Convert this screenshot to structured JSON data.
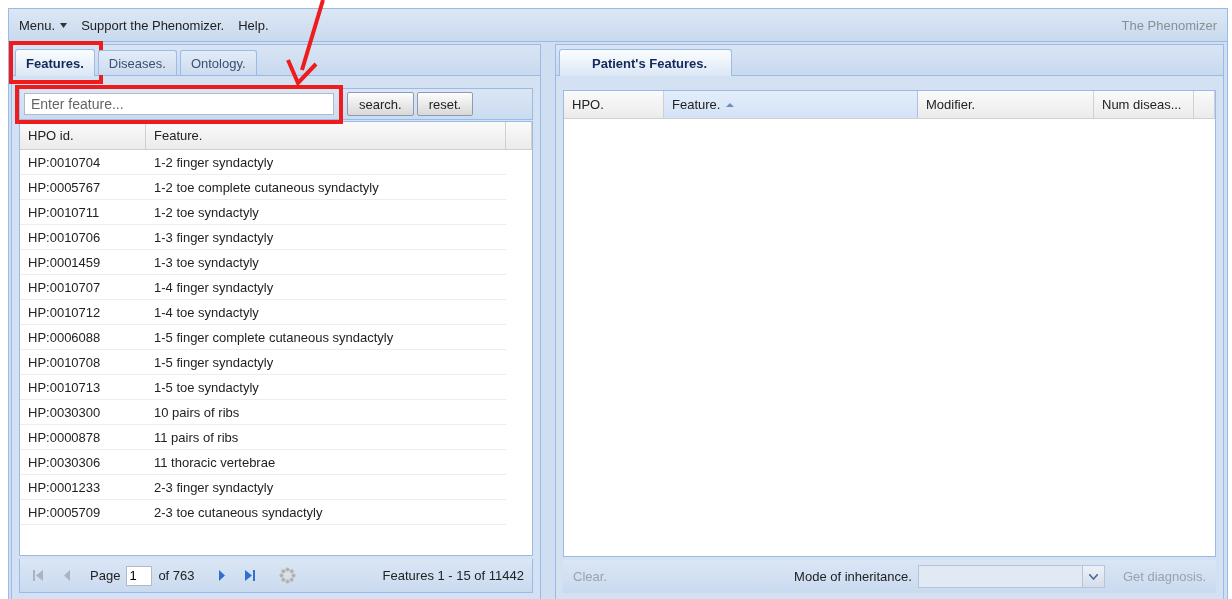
{
  "menu": [
    {
      "label": "Menu.",
      "dropdown": true
    },
    {
      "label": "Support the Phenomizer.",
      "dropdown": false
    },
    {
      "label": "Help.",
      "dropdown": false
    }
  ],
  "app_title": "The Phenomizer",
  "left_panel": {
    "tabs": [
      {
        "label": "Features.",
        "selected": true,
        "highlighted": true
      },
      {
        "label": "Diseases.",
        "selected": false,
        "highlighted": false
      },
      {
        "label": "Ontology.",
        "selected": false,
        "highlighted": false
      }
    ],
    "search": {
      "placeholder": "Enter feature...",
      "highlighted": true,
      "arrow": true
    },
    "buttons": [
      "search.",
      "reset."
    ],
    "grid": {
      "columns": [
        {
          "label": "HPO id."
        },
        {
          "label": "Feature."
        }
      ],
      "rows": [
        [
          "HP:0010704",
          "1-2 finger syndactyly"
        ],
        [
          "HP:0005767",
          "1-2 toe complete cutaneous syndactyly"
        ],
        [
          "HP:0010711",
          "1-2 toe syndactyly"
        ],
        [
          "HP:0010706",
          "1-3 finger syndactyly"
        ],
        [
          "HP:0001459",
          "1-3 toe syndactyly"
        ],
        [
          "HP:0010707",
          "1-4 finger syndactyly"
        ],
        [
          "HP:0010712",
          "1-4 toe syndactyly"
        ],
        [
          "HP:0006088",
          "1-5 finger complete cutaneous syndactyly"
        ],
        [
          "HP:0010708",
          "1-5 finger syndactyly"
        ],
        [
          "HP:0010713",
          "1-5 toe syndactyly"
        ],
        [
          "HP:0030300",
          "10 pairs of ribs"
        ],
        [
          "HP:0000878",
          "11 pairs of ribs"
        ],
        [
          "HP:0030306",
          "11 thoracic vertebrae"
        ],
        [
          "HP:0001233",
          "2-3 finger syndactyly"
        ],
        [
          "HP:0005709",
          "2-3 toe cutaneous syndactyly"
        ]
      ]
    },
    "pager": {
      "nav": [
        {
          "kind": "first",
          "disabled": true
        },
        {
          "kind": "prev",
          "disabled": true
        },
        {
          "kind": "page"
        },
        {
          "kind": "next",
          "disabled": false
        },
        {
          "kind": "last",
          "disabled": false
        },
        {
          "kind": "refresh",
          "disabled": true
        }
      ],
      "page_label": "Page",
      "page": "1",
      "page_count": "of 763",
      "summary": "Features 1 - 15 of 11442"
    }
  },
  "right_panel": {
    "tabs": [
      {
        "label": "Patient's Features.",
        "selected": true
      }
    ],
    "grid": {
      "columns": [
        {
          "label": "HPO.",
          "sorted": false
        },
        {
          "label": "Feature.",
          "sorted": true
        },
        {
          "label": "Modifier.",
          "sorted": false
        },
        {
          "label": "Num diseas...",
          "sorted": false
        }
      ]
    },
    "clear": {
      "label": "Clear.",
      "disabled": true
    },
    "mode_label": "Mode of inheritance.",
    "get_diagnosis": {
      "label": "Get diagnosis.",
      "disabled": true
    }
  }
}
